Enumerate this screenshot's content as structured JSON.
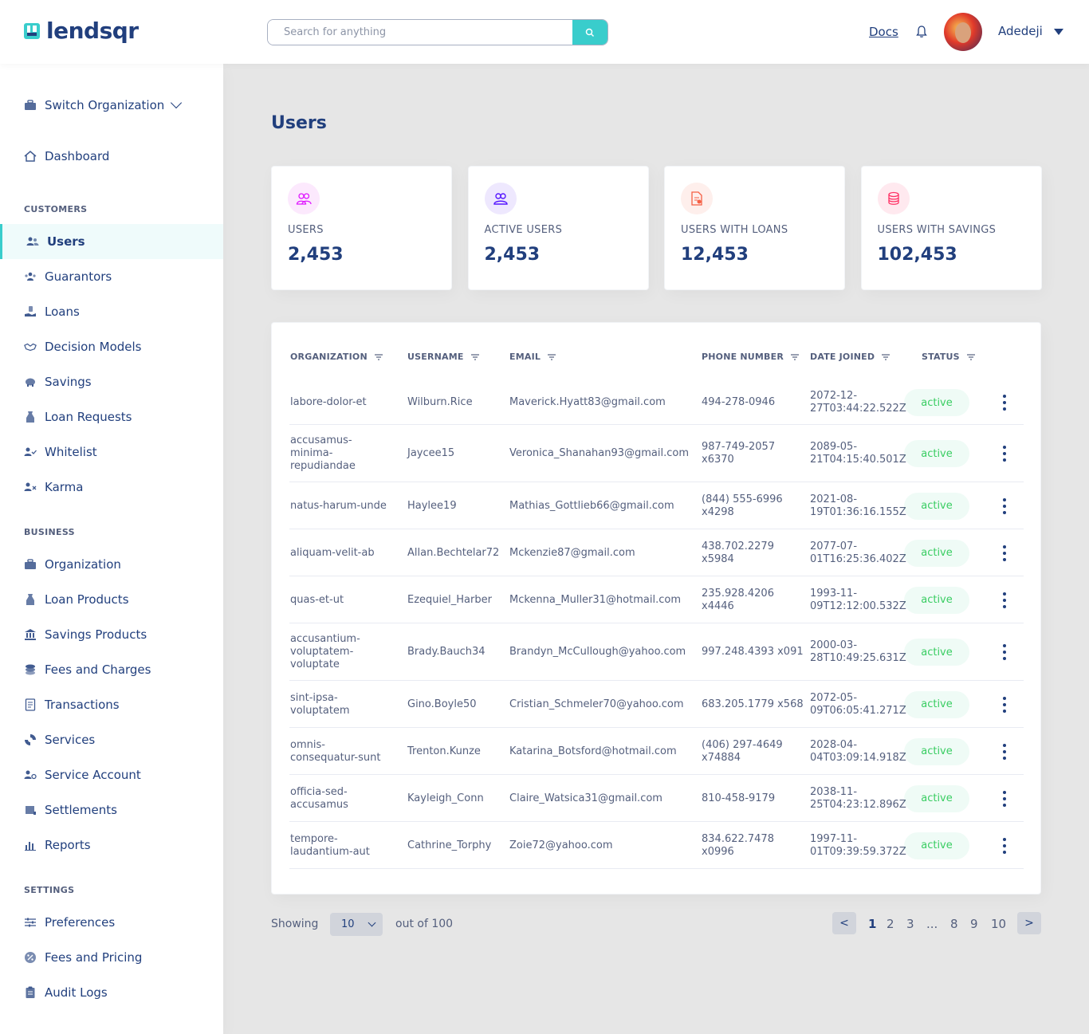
{
  "header": {
    "logo_text": "lendsqr",
    "search_placeholder": "Search for anything",
    "docs_label": "Docs",
    "user_name": "Adedeji"
  },
  "sidebar": {
    "switch_org": "Switch Organization",
    "dashboard": "Dashboard",
    "section_customers": "CUSTOMERS",
    "customers": [
      {
        "label": "Users",
        "icon": "users-icon"
      },
      {
        "label": "Guarantors",
        "icon": "guarantors-icon"
      },
      {
        "label": "Loans",
        "icon": "loans-icon"
      },
      {
        "label": "Decision Models",
        "icon": "handshake-icon"
      },
      {
        "label": "Savings",
        "icon": "piggy-bank-icon"
      },
      {
        "label": "Loan Requests",
        "icon": "loan-request-icon"
      },
      {
        "label": "Whitelist",
        "icon": "user-check-icon"
      },
      {
        "label": "Karma",
        "icon": "user-x-icon"
      }
    ],
    "section_business": "BUSINESS",
    "business": [
      {
        "label": "Organization",
        "icon": "briefcase-icon"
      },
      {
        "label": "Loan Products",
        "icon": "loan-products-icon"
      },
      {
        "label": "Savings Products",
        "icon": "bank-icon"
      },
      {
        "label": "Fees and Charges",
        "icon": "coins-icon"
      },
      {
        "label": "Transactions",
        "icon": "transactions-icon"
      },
      {
        "label": "Services",
        "icon": "services-icon"
      },
      {
        "label": "Service Account",
        "icon": "user-gear-icon"
      },
      {
        "label": "Settlements",
        "icon": "scroll-icon"
      },
      {
        "label": "Reports",
        "icon": "bar-chart-icon"
      }
    ],
    "section_settings": "SETTINGS",
    "settings": [
      {
        "label": "Preferences",
        "icon": "sliders-icon"
      },
      {
        "label": "Fees and Pricing",
        "icon": "percent-badge-icon"
      },
      {
        "label": "Audit Logs",
        "icon": "clipboard-icon"
      }
    ]
  },
  "main": {
    "title": "Users",
    "cards": [
      {
        "label": "USERS",
        "value": "2,453",
        "bg": "#fce9fd",
        "color": "#df18ff"
      },
      {
        "label": "ACTIVE USERS",
        "value": "2,453",
        "bg": "#eee8fe",
        "color": "#5718ff"
      },
      {
        "label": "USERS WITH LOANS",
        "value": "12,453",
        "bg": "#feefec",
        "color": "#f55f44"
      },
      {
        "label": "USERS WITH SAVINGS",
        "value": "102,453",
        "bg": "#ffe9ef",
        "color": "#ff3366"
      }
    ],
    "table": {
      "headers": [
        "ORGANIZATION",
        "USERNAME",
        "EMAIL",
        "PHONE NUMBER",
        "DATE JOINED",
        "STATUS"
      ],
      "rows": [
        {
          "org": [
            "labore-dolor-et"
          ],
          "username": "Wilburn.Rice",
          "email": "Maverick.Hyatt83@gmail.com",
          "phone": [
            "494-278-0946"
          ],
          "date": [
            "2072-12-",
            "27T03:44:22.522Z"
          ],
          "status": "active"
        },
        {
          "org": [
            "accusamus-",
            "minima-",
            "repudiandae"
          ],
          "username": "Jaycee15",
          "email": "Veronica_Shanahan93@gmail.com",
          "phone": [
            "987-749-2057",
            "x6370"
          ],
          "date": [
            "2089-05-",
            "21T04:15:40.501Z"
          ],
          "status": "active"
        },
        {
          "org": [
            "natus-harum-unde"
          ],
          "username": "Haylee19",
          "email": "Mathias_Gottlieb66@gmail.com",
          "phone": [
            "(844) 555-6996",
            "x4298"
          ],
          "date": [
            "2021-08-",
            "19T01:36:16.155Z"
          ],
          "status": "active"
        },
        {
          "org": [
            "aliquam-velit-ab"
          ],
          "username": "Allan.Bechtelar72",
          "email": "Mckenzie87@gmail.com",
          "phone": [
            "438.702.2279",
            "x5984"
          ],
          "date": [
            "2077-07-",
            "01T16:25:36.402Z"
          ],
          "status": "active"
        },
        {
          "org": [
            "quas-et-ut"
          ],
          "username": "Ezequiel_Harber",
          "email": "Mckenna_Muller31@hotmail.com",
          "phone": [
            "235.928.4206",
            "x4446"
          ],
          "date": [
            "1993-11-",
            "09T12:12:00.532Z"
          ],
          "status": "active"
        },
        {
          "org": [
            "accusantium-",
            "voluptatem-",
            "voluptate"
          ],
          "username": "Brady.Bauch34",
          "email": "Brandyn_McCullough@yahoo.com",
          "phone": [
            "997.248.4393 x091"
          ],
          "date": [
            "2000-03-",
            "28T10:49:25.631Z"
          ],
          "status": "active"
        },
        {
          "org": [
            "sint-ipsa-",
            "voluptatem"
          ],
          "username": "Gino.Boyle50",
          "email": "Cristian_Schmeler70@yahoo.com",
          "phone": [
            "683.205.1779 x568"
          ],
          "date": [
            "2072-05-",
            "09T06:05:41.271Z"
          ],
          "status": "active"
        },
        {
          "org": [
            "omnis-",
            "consequatur-sunt"
          ],
          "username": "Trenton.Kunze",
          "email": "Katarina_Botsford@hotmail.com",
          "phone": [
            "(406) 297-4649",
            "x74884"
          ],
          "date": [
            "2028-04-",
            "04T03:09:14.918Z"
          ],
          "status": "active"
        },
        {
          "org": [
            "officia-sed-",
            "accusamus"
          ],
          "username": "Kayleigh_Conn",
          "email": "Claire_Watsica31@gmail.com",
          "phone": [
            "810-458-9179"
          ],
          "date": [
            "2038-11-",
            "25T04:23:12.896Z"
          ],
          "status": "active"
        },
        {
          "org": [
            "tempore-",
            "laudantium-aut"
          ],
          "username": "Cathrine_Torphy",
          "email": "Zoie72@yahoo.com",
          "phone": [
            "834.622.7478",
            "x0996"
          ],
          "date": [
            "1997-11-",
            "01T09:39:59.372Z"
          ],
          "status": "active"
        }
      ]
    },
    "pagination": {
      "showing_label": "Showing",
      "per_page": "10",
      "out_of_label": "out of 100",
      "prev": "<",
      "next": ">",
      "pages": [
        "1",
        "2",
        "3",
        "...",
        "8",
        "9",
        "10"
      ],
      "current": "1"
    }
  }
}
